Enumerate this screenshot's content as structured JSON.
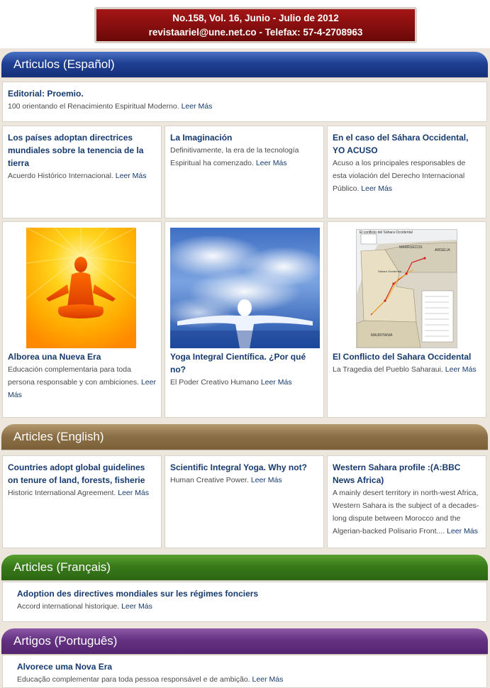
{
  "masthead": {
    "line1": "No.158, Vol. 16, Junio  - Julio de 2012",
    "line2": "revistaariel@une.net.co - Telefax: 57-4-2708963"
  },
  "read_more": "Leer Más",
  "sections": {
    "es": {
      "heading": "Articulos   (Español)",
      "editorial": {
        "title": "Editorial: Proemio.",
        "desc": "100 orientando el Renacimiento Espiritual Moderno."
      },
      "row1": [
        {
          "title": "Los países adoptan directrices mundiales sobre la tenencia de la tierra",
          "desc": "Acuerdo Histórico Internacional."
        },
        {
          "title": "La Imaginación",
          "desc": "Definitivamente, la era de la tecnología Espiritual ha comenzado."
        },
        {
          "title": "En el caso del Sáhara Occidental, YO ACUSO",
          "desc": "Acuso a los principales responsables de esta violación del Derecho Internacional Público."
        }
      ],
      "row2": [
        {
          "title": "Alborea una Nueva Era",
          "desc": "Educación complementaria para toda persona responsable y con ambiciones."
        },
        {
          "title": "Yoga Integral Científica. ¿Por qué no?",
          "desc": "El Poder Creativo Humano"
        },
        {
          "title": "El Conflicto del Sahara Occidental",
          "desc": "La Tragedia del Pueblo Saharaui."
        }
      ],
      "map_labels": {
        "caption": "El conflicto del Sáhara Occidental",
        "country_1": "MARRUECOS",
        "country_2": "ARGELIA",
        "country_3": "MAURITANIA",
        "region": "Sáhara Occidental"
      }
    },
    "en": {
      "heading": "Articles (English)",
      "items": [
        {
          "title": "Countries adopt global guidelines on tenure of land, forests, fisherie",
          "desc": "Historic International Agreement."
        },
        {
          "title": "Scientific Integral Yoga. Why not?",
          "desc": "Human Creative Power."
        },
        {
          "title": "Western Sahara profile :(A:BBC News Africa)",
          "desc": "A mainly desert territory in north-west Africa, Western Sahara is the subject of a decades-long dispute between Morocco and the Algerian-backed Polisario Front...."
        }
      ]
    },
    "fr": {
      "heading": "Articles (Français)",
      "item": {
        "title": "Adoption des directives mondiales sur les régimes fonciers",
        "desc": "Accord international historique."
      }
    },
    "pt": {
      "heading": "Artigos (Português)",
      "item": {
        "title": "Alvorece uma Nova Era",
        "desc": "Educação  complementar para toda pessoa responsável e de ambição."
      }
    }
  },
  "colors": {
    "link": "#163a6e",
    "band_es": "#1f3f92",
    "band_en": "#8c7048",
    "band_fr": "#387a1a",
    "band_pt": "#643282",
    "masthead": "#8a1010"
  }
}
